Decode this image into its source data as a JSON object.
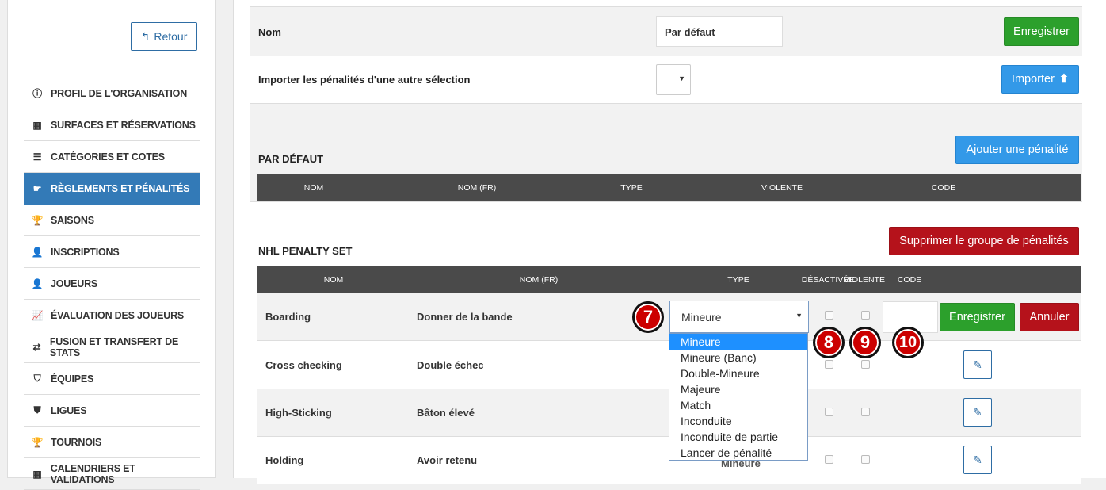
{
  "sidebar": {
    "back_label": "Retour",
    "items": [
      {
        "label": "PROFIL DE L'ORGANISATION",
        "icon": "info-circle-icon",
        "glyph": "ⓘ"
      },
      {
        "label": "SURFACES ET RÉSERVATIONS",
        "icon": "grid-icon",
        "glyph": "▦"
      },
      {
        "label": "CATÉGORIES ET COTES",
        "icon": "list-icon",
        "glyph": "☰"
      },
      {
        "label": "RÈGLEMENTS ET PÉNALITÉS",
        "icon": "hand-point-icon",
        "glyph": "☛"
      },
      {
        "label": "SAISONS",
        "icon": "trophy-icon",
        "glyph": "🏆"
      },
      {
        "label": "INSCRIPTIONS",
        "icon": "user-add-icon",
        "glyph": "👤"
      },
      {
        "label": "JOUEURS",
        "icon": "user-icon",
        "glyph": "👤"
      },
      {
        "label": "ÉVALUATION DES JOUEURS",
        "icon": "line-chart-icon",
        "glyph": "📈"
      },
      {
        "label": "FUSION ET TRANSFERT DE STATS",
        "icon": "transfer-icon",
        "glyph": "⇄"
      },
      {
        "label": "ÉQUIPES",
        "icon": "shield-icon",
        "glyph": "⛉"
      },
      {
        "label": "LIGUES",
        "icon": "badge-icon",
        "glyph": "⛊"
      },
      {
        "label": "TOURNOIS",
        "icon": "trophy-icon",
        "glyph": "🏆"
      },
      {
        "label": "CALENDRIERS ET VALIDATIONS",
        "icon": "calendar-icon",
        "glyph": "▦"
      }
    ],
    "active_index": 3
  },
  "form": {
    "name_label": "Nom",
    "name_value": "Par défaut",
    "save_label": "Enregistrer",
    "import_label": "Importer les pénalités d'une autre sélection",
    "import_button": "Importer"
  },
  "default_group": {
    "title": "PAR DÉFAUT",
    "add_button": "Ajouter une pénalité",
    "columns": [
      "NOM",
      "NOM (FR)",
      "TYPE",
      "VIOLENTE",
      "CODE"
    ]
  },
  "nhl_group": {
    "title": "NHL PENALTY SET",
    "delete_button": "Supprimer le groupe de pénalités",
    "columns": [
      "NOM",
      "NOM (FR)",
      "TYPE",
      "DÉSACTIVÉE",
      "VIOLENTE",
      "CODE"
    ],
    "edit_row": {
      "name": "Boarding",
      "name_fr": "Donner de la bande",
      "type_value": "Mineure",
      "save_label": "Enregistrer",
      "cancel_label": "Annuler"
    },
    "rows": [
      {
        "name": "Cross checking",
        "name_fr": "Double échec",
        "type": ""
      },
      {
        "name": "High-Sticking",
        "name_fr": "Bâton élevé",
        "type": ""
      },
      {
        "name": "Holding",
        "name_fr": "Avoir retenu",
        "type": "Mineure"
      }
    ]
  },
  "type_dropdown": {
    "options": [
      "Mineure",
      "Mineure (Banc)",
      "Double-Mineure",
      "Majeure",
      "Match",
      "Inconduite",
      "Inconduite de partie",
      "Lancer de pénalité"
    ],
    "selected_index": 0
  },
  "annotations": [
    "7",
    "8",
    "9",
    "10"
  ]
}
